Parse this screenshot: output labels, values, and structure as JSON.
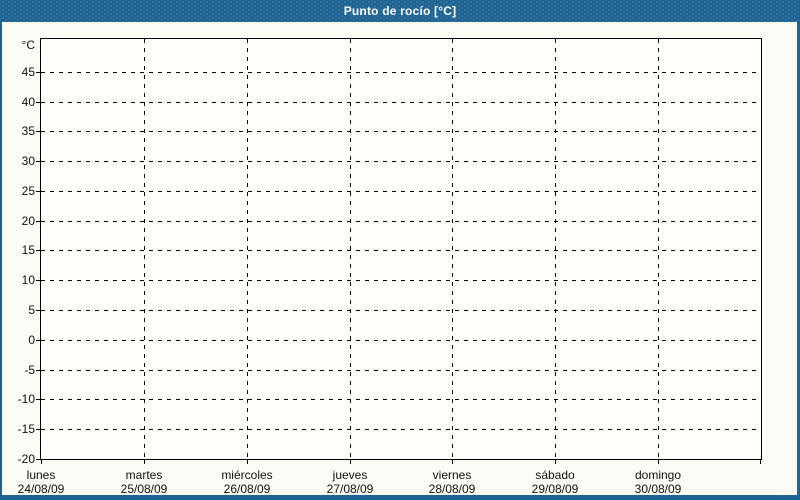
{
  "window": {
    "title": "Punto de rocío [°C]"
  },
  "chart_data": {
    "type": "line",
    "title": "Punto de rocío [°C]",
    "xlabel": "",
    "ylabel": "°C",
    "ylim": [
      -20,
      50.5
    ],
    "y_ticks": [
      45,
      40,
      35,
      30,
      25,
      20,
      15,
      10,
      5,
      0,
      -5,
      -10,
      -15,
      -20
    ],
    "y_tick_step": 5,
    "x_categories": [
      {
        "day": "lunes",
        "date": "24/08/09"
      },
      {
        "day": "martes",
        "date": "25/08/09"
      },
      {
        "day": "miércoles",
        "date": "26/08/09"
      },
      {
        "day": "jueves",
        "date": "27/08/09"
      },
      {
        "day": "viernes",
        "date": "28/08/09"
      },
      {
        "day": "sábado",
        "date": "29/08/09"
      },
      {
        "day": "domingo",
        "date": "30/08/09"
      }
    ],
    "x_divisions": 7,
    "series": [],
    "grid": {
      "style": "dashed",
      "color": "#000000",
      "horizontal": true,
      "vertical": true
    },
    "legend": "none"
  },
  "colors": {
    "frame_blue": "#1d6394",
    "title_text": "#ffffff",
    "canvas_background": "#fbfcf3",
    "plot_background": "#fefefb",
    "axis": "#000000",
    "label_text": "#111111"
  }
}
